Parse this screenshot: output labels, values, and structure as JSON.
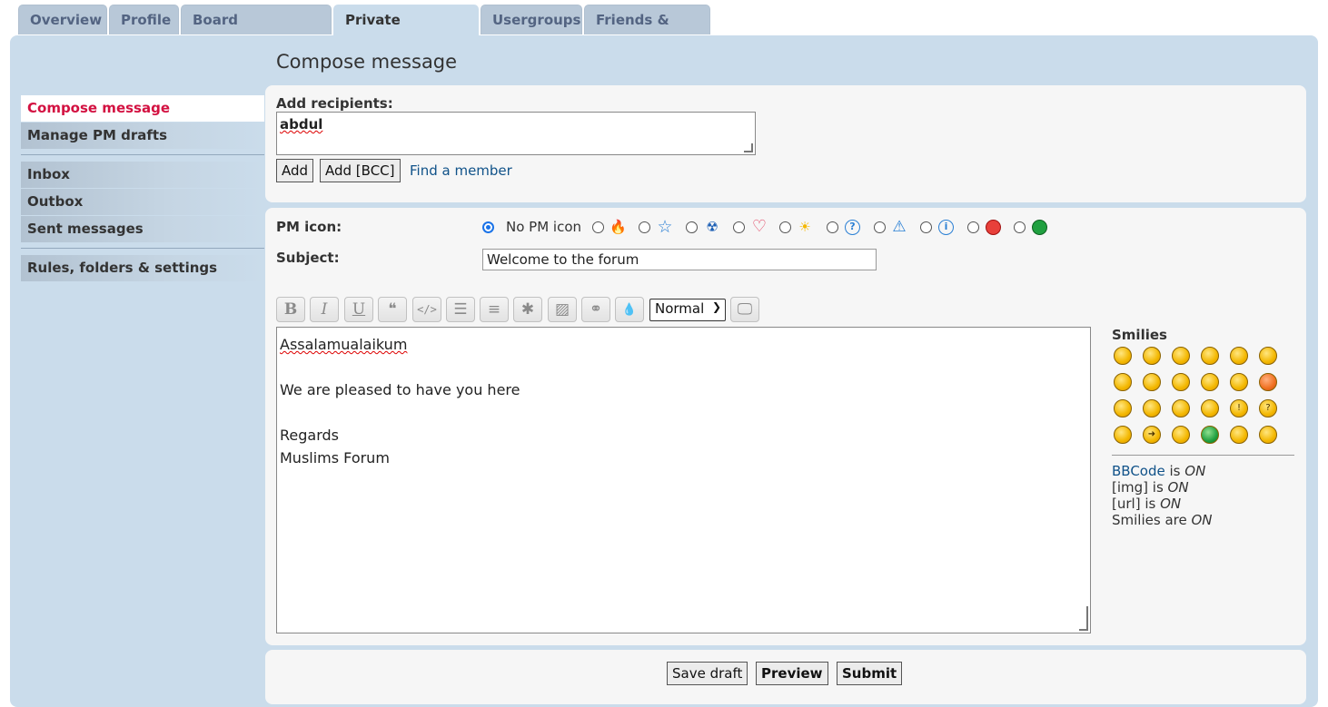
{
  "tabs": [
    {
      "label": "Overview"
    },
    {
      "label": "Profile"
    },
    {
      "label": "Board preferences"
    },
    {
      "label": "Private messages",
      "active": true
    },
    {
      "label": "Usergroups"
    },
    {
      "label": "Friends & Foes"
    }
  ],
  "page_title": "Compose message",
  "sidebar": {
    "group1": [
      {
        "label": "Compose message",
        "active": true
      },
      {
        "label": "Manage PM drafts"
      }
    ],
    "group2": [
      {
        "label": "Inbox"
      },
      {
        "label": "Outbox"
      },
      {
        "label": "Sent messages"
      }
    ],
    "group3": [
      {
        "label": "Rules, folders & settings"
      }
    ]
  },
  "recipients": {
    "label": "Add recipients:",
    "value": "abdul",
    "add_label": "Add",
    "add_bcc_label": "Add [BCC]",
    "find_member_label": "Find a member"
  },
  "pm_icon": {
    "label": "PM icon:",
    "none_label": "No PM icon",
    "icons": [
      "fire-icon",
      "star-icon",
      "radioactive-icon",
      "heart-icon",
      "lightbulb-icon",
      "question-icon",
      "warning-icon",
      "info-icon",
      "mrgreen-icon",
      "grin-icon"
    ]
  },
  "subject": {
    "label": "Subject:",
    "value": "Welcome to the forum"
  },
  "toolbar": {
    "buttons": [
      {
        "name": "bold-button",
        "glyph": "B"
      },
      {
        "name": "italic-button",
        "glyph": "I"
      },
      {
        "name": "underline-button",
        "glyph": "U"
      },
      {
        "name": "quote-button",
        "glyph": "❝"
      },
      {
        "name": "code-button",
        "glyph": "</>"
      },
      {
        "name": "list-button",
        "glyph": "☰"
      },
      {
        "name": "ordered-list-button",
        "glyph": "≡"
      },
      {
        "name": "list-item-button",
        "glyph": "✱"
      },
      {
        "name": "image-button",
        "glyph": "▨"
      },
      {
        "name": "link-button",
        "glyph": "⚭"
      },
      {
        "name": "color-button",
        "glyph": "💧"
      }
    ],
    "font_size_value": "Normal",
    "preview_glyph": "🖵"
  },
  "message": {
    "lines": [
      "Assalamualaikum",
      "",
      "We are pleased to have you here",
      "",
      "Regards",
      "Muslims Forum"
    ]
  },
  "smilies": {
    "title": "Smilies",
    "rows": [
      [
        ":D",
        ":)",
        ";)",
        ":(",
        ":o",
        ":shock:"
      ],
      [
        ":?",
        "8-)",
        ":lol:",
        ":x",
        ":P",
        ":oops:"
      ],
      [
        ":cry:",
        ":evil:",
        ":twisted:",
        ":roll:",
        ":!:",
        ":?:"
      ],
      [
        ":idea:",
        ":arrow:",
        ":|",
        ":mrgreen:",
        ":geek:",
        ":ugeek:"
      ]
    ]
  },
  "status": {
    "bbcode_link": "BBCode",
    "bbcode_text": "is",
    "on": "ON",
    "img": "[img] is",
    "url": "[url] is",
    "smilies": "Smilies are"
  },
  "actions": {
    "save_draft": "Save draft",
    "preview": "Preview",
    "submit": "Submit"
  }
}
